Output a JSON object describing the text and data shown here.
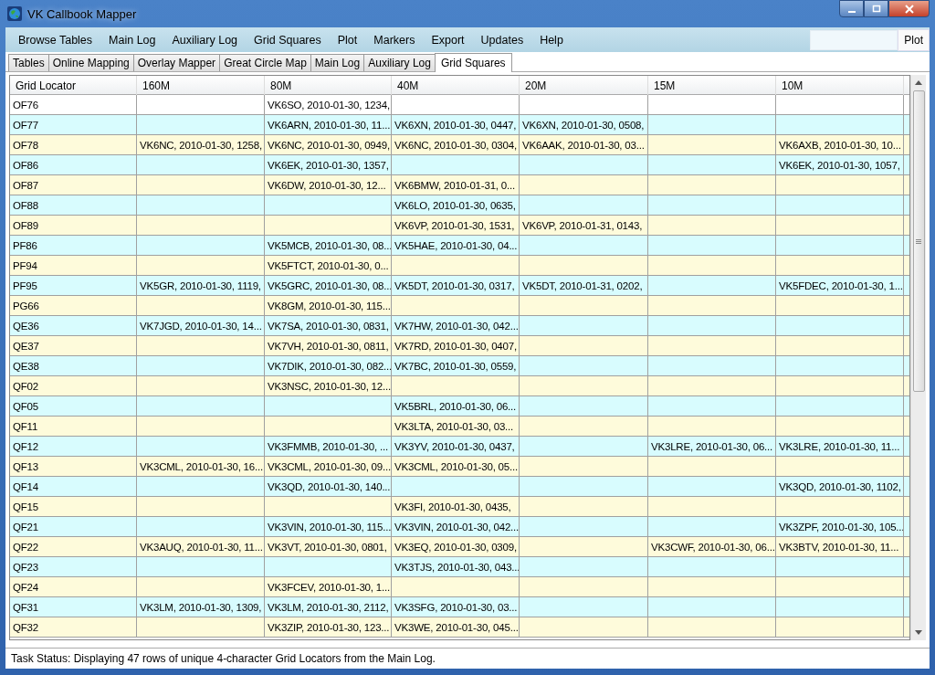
{
  "window": {
    "title": "VK Callbook Mapper"
  },
  "menu": [
    "Browse Tables",
    "Main Log",
    "Auxiliary Log",
    "Grid Squares",
    "Plot",
    "Markers",
    "Export",
    "Updates",
    "Help"
  ],
  "plot_button": "Plot",
  "tabs": [
    {
      "label": "Tables",
      "selected": false
    },
    {
      "label": "Online Mapping",
      "selected": false
    },
    {
      "label": "Overlay Mapper",
      "selected": false
    },
    {
      "label": "Great Circle Map",
      "selected": false
    },
    {
      "label": "Main Log",
      "selected": false
    },
    {
      "label": "Auxiliary Log",
      "selected": false
    },
    {
      "label": "Grid Squares",
      "selected": true
    }
  ],
  "table": {
    "columns": [
      "Grid Locator",
      "160M",
      "80M",
      "40M",
      "20M",
      "15M",
      "10M"
    ],
    "rows": [
      {
        "selected": true,
        "cells": [
          "OF76",
          null,
          "VK6SO, 2010-01-30, 1234,",
          null,
          null,
          null,
          null
        ]
      },
      {
        "selected": false,
        "cells": [
          "OF77",
          null,
          "VK6ARN, 2010-01-30, 11...",
          "VK6XN, 2010-01-30, 0447,",
          "VK6XN, 2010-01-30, 0508,",
          null,
          null
        ]
      },
      {
        "selected": false,
        "cells": [
          "OF78",
          "VK6NC, 2010-01-30, 1258,",
          "VK6NC, 2010-01-30, 0949,",
          "VK6NC, 2010-01-30, 0304,",
          "VK6AAK, 2010-01-30, 03...",
          null,
          "VK6AXB, 2010-01-30, 10..."
        ]
      },
      {
        "selected": false,
        "cells": [
          "OF86",
          null,
          "VK6EK, 2010-01-30, 1357,",
          null,
          null,
          null,
          "VK6EK, 2010-01-30, 1057,"
        ]
      },
      {
        "selected": false,
        "cells": [
          "OF87",
          null,
          "VK6DW, 2010-01-30, 12...",
          "VK6BMW, 2010-01-31, 0...",
          null,
          null,
          null
        ]
      },
      {
        "selected": false,
        "cells": [
          "OF88",
          null,
          null,
          "VK6LO, 2010-01-30, 0635,",
          null,
          null,
          null
        ]
      },
      {
        "selected": false,
        "cells": [
          "OF89",
          null,
          null,
          "VK6VP, 2010-01-30, 1531,",
          "VK6VP, 2010-01-31, 0143,",
          null,
          null
        ]
      },
      {
        "selected": false,
        "cells": [
          "PF86",
          null,
          "VK5MCB, 2010-01-30, 08...",
          "VK5HAE, 2010-01-30, 04...",
          null,
          null,
          null
        ]
      },
      {
        "selected": false,
        "cells": [
          "PF94",
          null,
          "VK5FTCT, 2010-01-30, 0...",
          null,
          null,
          null,
          null
        ]
      },
      {
        "selected": false,
        "cells": [
          "PF95",
          "VK5GR, 2010-01-30, 1119,",
          "VK5GRC, 2010-01-30, 08...",
          "VK5DT, 2010-01-30, 0317,",
          "VK5DT, 2010-01-31, 0202,",
          null,
          "VK5FDEC, 2010-01-30, 1..."
        ]
      },
      {
        "selected": false,
        "cells": [
          "PG66",
          null,
          "VK8GM, 2010-01-30, 115...",
          null,
          null,
          null,
          null
        ]
      },
      {
        "selected": false,
        "cells": [
          "QE36",
          "VK7JGD, 2010-01-30, 14...",
          "VK7SA, 2010-01-30, 0831,",
          "VK7HW, 2010-01-30, 042...",
          null,
          null,
          null
        ]
      },
      {
        "selected": false,
        "cells": [
          "QE37",
          null,
          "VK7VH, 2010-01-30, 0811,",
          "VK7RD, 2010-01-30, 0407,",
          null,
          null,
          null
        ]
      },
      {
        "selected": false,
        "cells": [
          "QE38",
          null,
          "VK7DIK, 2010-01-30, 082...",
          "VK7BC, 2010-01-30, 0559,",
          null,
          null,
          null
        ]
      },
      {
        "selected": false,
        "cells": [
          "QF02",
          null,
          "VK3NSC, 2010-01-30, 12...",
          null,
          null,
          null,
          null
        ]
      },
      {
        "selected": false,
        "cells": [
          "QF05",
          null,
          null,
          "VK5BRL, 2010-01-30, 06...",
          null,
          null,
          null
        ]
      },
      {
        "selected": false,
        "cells": [
          "QF11",
          null,
          null,
          "VK3LTA, 2010-01-30, 03...",
          null,
          null,
          null
        ]
      },
      {
        "selected": false,
        "cells": [
          "QF12",
          null,
          "VK3FMMB, 2010-01-30, ...",
          "VK3YV, 2010-01-30, 0437,",
          null,
          "VK3LRE, 2010-01-30, 06...",
          "VK3LRE, 2010-01-30, 11..."
        ]
      },
      {
        "selected": false,
        "cells": [
          "QF13",
          "VK3CML, 2010-01-30, 16...",
          "VK3CML, 2010-01-30, 09...",
          "VK3CML, 2010-01-30, 05...",
          null,
          null,
          null
        ]
      },
      {
        "selected": false,
        "cells": [
          "QF14",
          null,
          "VK3QD, 2010-01-30, 140...",
          null,
          null,
          null,
          "VK3QD, 2010-01-30, 1102,"
        ]
      },
      {
        "selected": false,
        "cells": [
          "QF15",
          null,
          null,
          "VK3FI, 2010-01-30, 0435,",
          null,
          null,
          null
        ]
      },
      {
        "selected": false,
        "cells": [
          "QF21",
          null,
          "VK3VIN, 2010-01-30, 115...",
          "VK3VIN, 2010-01-30, 042...",
          null,
          null,
          "VK3ZPF, 2010-01-30, 105..."
        ]
      },
      {
        "selected": false,
        "cells": [
          "QF22",
          "VK3AUQ, 2010-01-30, 11...",
          "VK3VT, 2010-01-30, 0801,",
          "VK3EQ, 2010-01-30, 0309,",
          null,
          "VK3CWF, 2010-01-30, 06...",
          "VK3BTV, 2010-01-30, 11..."
        ]
      },
      {
        "selected": false,
        "cells": [
          "QF23",
          null,
          null,
          "VK3TJS, 2010-01-30, 043...",
          null,
          null,
          null
        ]
      },
      {
        "selected": false,
        "cells": [
          "QF24",
          null,
          "VK3FCEV, 2010-01-30, 1...",
          null,
          null,
          null,
          null
        ]
      },
      {
        "selected": false,
        "cells": [
          "QF31",
          "VK3LM, 2010-01-30, 1309,",
          "VK3LM, 2010-01-30, 2112,",
          "VK3SFG, 2010-01-30, 03...",
          null,
          null,
          null
        ]
      },
      {
        "selected": false,
        "cells": [
          "QF32",
          null,
          "VK3ZIP, 2010-01-30, 123...",
          "VK3WE, 2010-01-30, 045...",
          null,
          null,
          null
        ]
      }
    ]
  },
  "status_bar": "Task Status: Displaying 47 rows of unique 4-character Grid Locators from the Main Log."
}
